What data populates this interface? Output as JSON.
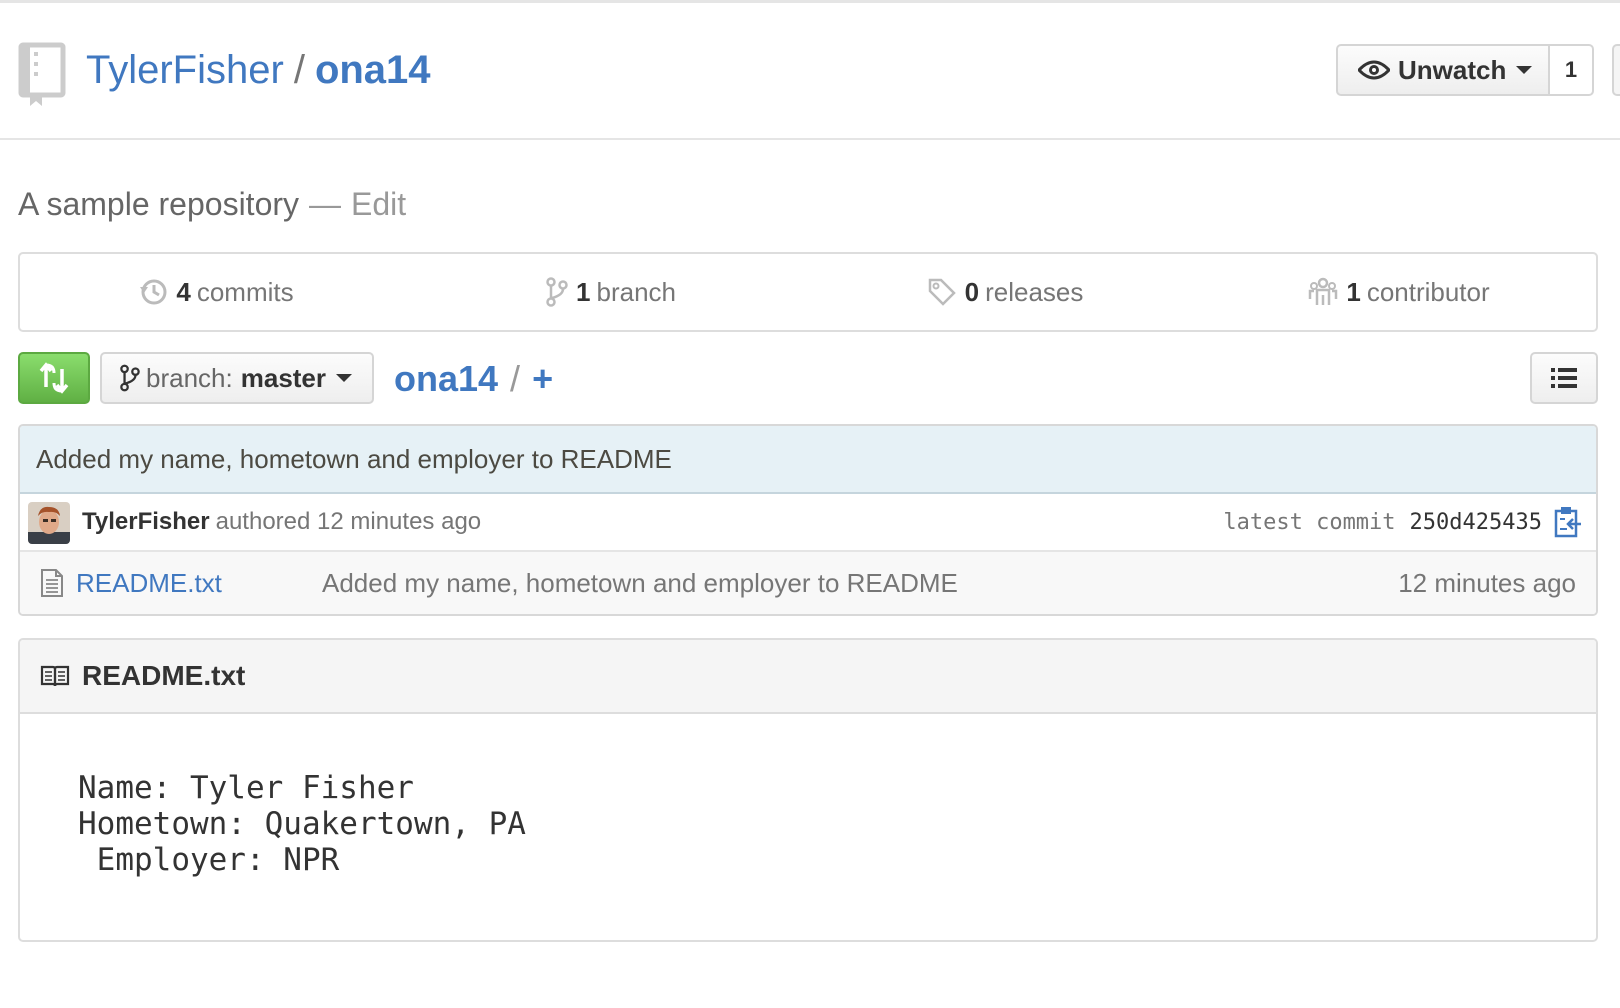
{
  "repo": {
    "owner": "TylerFisher",
    "separator": "/",
    "name": "ona14"
  },
  "watch": {
    "label": "Unwatch",
    "count": "1"
  },
  "description": {
    "text": "A sample repository",
    "dash": "—",
    "edit_label": "Edit"
  },
  "summary": {
    "commits": {
      "count": "4",
      "label": "commits"
    },
    "branches": {
      "count": "1",
      "label": "branch"
    },
    "releases": {
      "count": "0",
      "label": "releases"
    },
    "contributors": {
      "count": "1",
      "label": "contributor"
    }
  },
  "file_nav": {
    "branch_prefix": "branch:",
    "branch_name": "master",
    "breadcrumb_root": "ona14",
    "breadcrumb_sep": "/",
    "breadcrumb_add": "+"
  },
  "latest_commit": {
    "message": "Added my name, hometown and employer to README",
    "author": "TylerFisher",
    "authored_text": "authored 12 minutes ago",
    "sha_label": "latest commit",
    "sha": "250d425435"
  },
  "files": [
    {
      "name": "README.txt",
      "message": "Added my name, hometown and employer to README",
      "age": "12 minutes ago"
    }
  ],
  "readme": {
    "title": "README.txt",
    "content": "Name: Tyler Fisher\nHometown: Quakertown, PA\n Employer: NPR"
  },
  "colors": {
    "link": "#4078c0",
    "commit_bar": "#e6f1f6",
    "compare_green": "#60b044"
  },
  "icons": {
    "repo": "repo-icon",
    "watch": "eye-icon",
    "commits": "history-icon",
    "branch": "git-branch-icon",
    "releases": "tag-icon",
    "contributors": "organization-icon",
    "compare": "git-compare-icon",
    "file": "file-text-icon",
    "copy": "clippy-icon",
    "list": "list-unordered-icon",
    "readme": "book-icon"
  }
}
